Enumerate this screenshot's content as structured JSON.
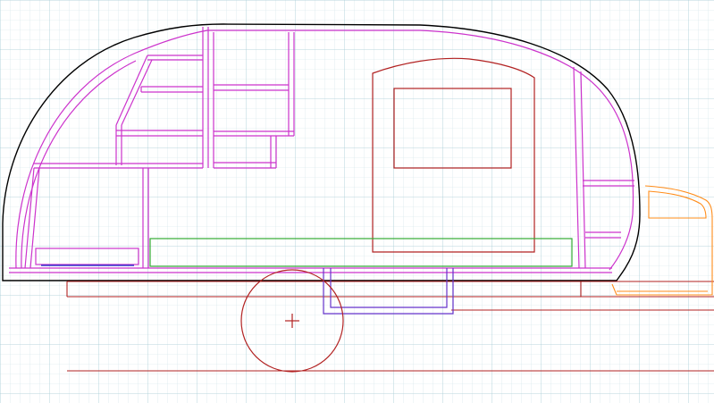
{
  "drawing": {
    "kind": "teardrop trailer side elevation",
    "grid": true,
    "colors": {
      "background": "#ffffff",
      "grid_minor": "#cfe3e8",
      "grid_major": "#a9cdd6",
      "outer_shell": "#000000",
      "framing": "#cc33cc",
      "door": "#b22222",
      "chassis": "#b22222",
      "wheel": "#b22222",
      "mattress": "#33aa33",
      "axle_mount": "#6633cc",
      "storage_drawer": "#3333cc",
      "tongue_box": "#ff8c1a"
    }
  }
}
